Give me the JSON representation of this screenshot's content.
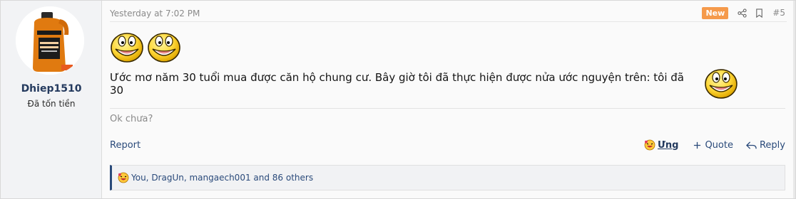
{
  "post": {
    "user": {
      "username": "Dhiep1510",
      "title": "Đã tốn tiền",
      "avatar_icon": "cleaner-bottle-avatar"
    },
    "meta": {
      "time": "Yesterday at 7:02 PM",
      "badge": "New",
      "share_icon": "share-icon",
      "bookmark_icon": "bookmark-icon",
      "number": "#5"
    },
    "body": {
      "smilies_icon": "laughing-smiley-icon",
      "text": "Ước mơ năm 30 tuổi mua được căn hộ chung cư. Bây giờ tôi đã thực hiện được nửa ước nguyện trên: tôi đã 30"
    },
    "signature": "Ok chưa?",
    "actions": {
      "report": "Report",
      "react": "Ưng",
      "quote": "Quote",
      "reply": "Reply"
    },
    "reactions": {
      "summary": "You, DragUn, mangaech001 and 86 others"
    },
    "colors": {
      "accent": "#2a4a7a",
      "badge": "#f59a4b",
      "smiley_yellow": "#ffd83a"
    }
  }
}
